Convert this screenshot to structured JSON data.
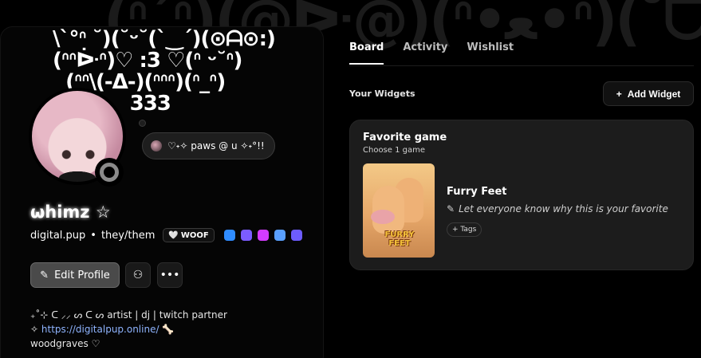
{
  "background_art": "(ᐢ´ᐢ)(@ᐕ@)(ᐢ•ﻌ•ᐢ)(˘ᗜ˘)",
  "profile": {
    "banner_art": "\\ˋ°ᐢ ˘)(˘ᵕ˘(ˋ‿ˊ)(⊙ᗩ⊙:)\n(ᐢᐢᐕᐢ)♡ :3 ♡(ᐢ ᵕ˘ᐢ)\n  (ᐢᐢ\\(-Δ-)(ᐢᐢᐢ)(ᐢ_ᐢ)\n            333",
    "status_text": "♡˖✧ paws @ u ✧˖°!!",
    "display_name": "ωhimz ☆",
    "username": "digital.pup",
    "separator": "•",
    "pronouns": "they/them",
    "tag_icon": "🤍",
    "tag_label": "WOOF",
    "badges": [
      {
        "name": "orb-badge",
        "color": "#2f8cff"
      },
      {
        "name": "shield-badge",
        "color": "#7b5cff"
      },
      {
        "name": "gem-badge",
        "color": "#d43bff"
      },
      {
        "name": "gear-badge",
        "color": "#5aa0ff"
      },
      {
        "name": "star-badge",
        "color": "#6d5cff"
      }
    ],
    "edit_profile_label": "Edit Profile",
    "bio_line1": "₊˚⊹ ᑕ ⸝⸝ ᔕ ᑕ ᔕ artist | dj | twitch partner",
    "bio_link_icon": "✧",
    "bio_link": "https://digitalpup.online/",
    "bio_link_suffix": "🦴",
    "bio_line3": "woodgraves ♡"
  },
  "tabs": [
    "Board",
    "Activity",
    "Wishlist"
  ],
  "active_tab": "Board",
  "widgets_section_label": "Your Widgets",
  "add_widget_label": "Add Widget",
  "favorite_game_card": {
    "title": "Favorite game",
    "subtitle": "Choose 1 game",
    "game_name": "Furry Feet",
    "game_cover_logo": "FURRY FEET",
    "note": "Let everyone know why this is your favorite",
    "tags_label": "+ Tags"
  }
}
